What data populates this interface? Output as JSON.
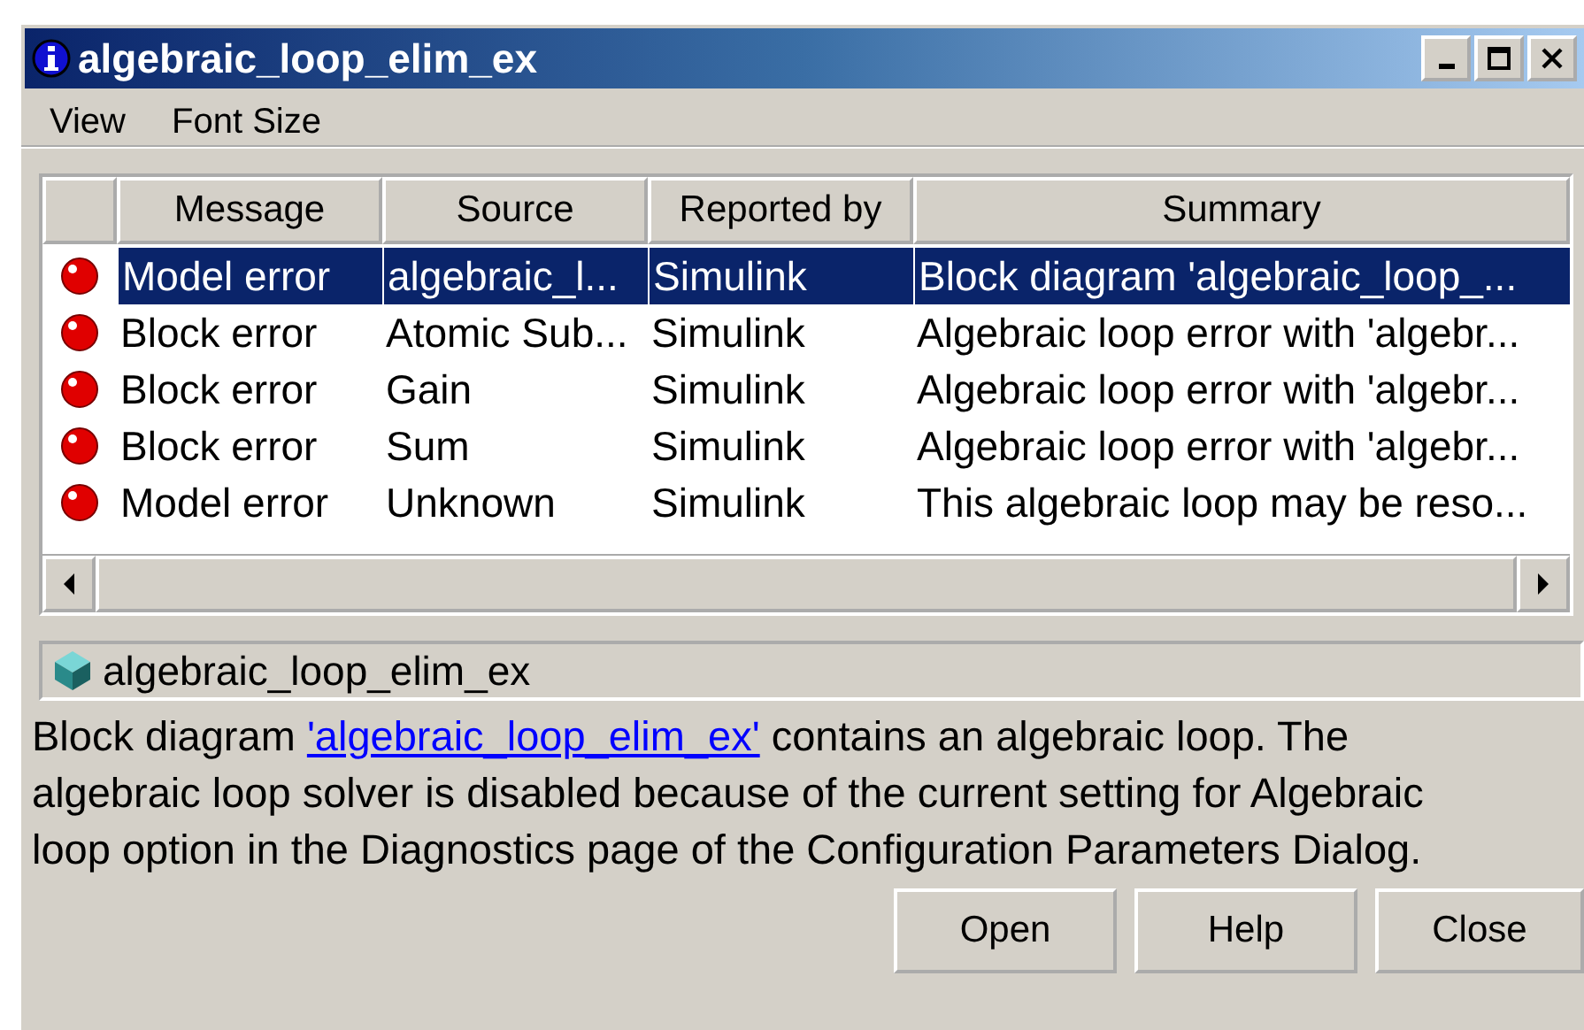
{
  "window": {
    "title": "algebraic_loop_elim_ex"
  },
  "menu": [
    "View",
    "Font Size"
  ],
  "table": {
    "columns": [
      "Message",
      "Source",
      "Reported by",
      "Summary"
    ],
    "rows": [
      {
        "cells": [
          "Model error",
          "algebraic_l...",
          "Simulink",
          "Block diagram 'algebraic_loop_..."
        ],
        "selected": true
      },
      {
        "cells": [
          "Block error",
          "Atomic Sub...",
          "Simulink",
          "Algebraic loop error with 'algebr..."
        ],
        "selected": false
      },
      {
        "cells": [
          "Block error",
          "Gain",
          "Simulink",
          "Algebraic loop error with 'algebr..."
        ],
        "selected": false
      },
      {
        "cells": [
          "Block error",
          "Sum",
          "Simulink",
          "Algebraic loop error with 'algebr..."
        ],
        "selected": false
      },
      {
        "cells": [
          "Model error",
          "Unknown",
          "Simulink",
          "This algebraic loop may be reso..."
        ],
        "selected": false
      }
    ]
  },
  "detail": {
    "source": "algebraic_loop_elim_ex",
    "text_before": "Block diagram ",
    "link": "'algebraic_loop_elim_ex'",
    "text_after": " contains an algebraic loop. The algebraic loop solver is disabled because of the current setting for Algebraic loop option in the Diagnostics page of the Configuration Parameters Dialog."
  },
  "buttons": [
    "Open",
    "Help",
    "Close"
  ]
}
